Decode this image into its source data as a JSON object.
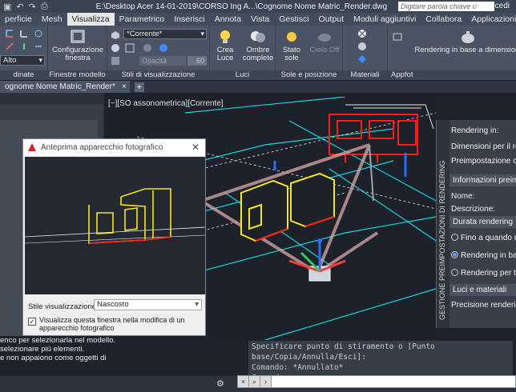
{
  "titlebar": {
    "document_path": "E:\\Desktop Acer 14-01-2019\\CORSO Ing A...\\Cognome Nome Matric_Render.dwg",
    "search_placeholder": "Digitare parola chiave o frase",
    "login_label": "Accedi"
  },
  "menu_tabs": [
    {
      "label": "perficie",
      "active": false
    },
    {
      "label": "Mesh",
      "active": false
    },
    {
      "label": "Visualizza",
      "active": true
    },
    {
      "label": "Parametrico",
      "active": false
    },
    {
      "label": "Inserisci",
      "active": false
    },
    {
      "label": "Annota",
      "active": false
    },
    {
      "label": "Vista",
      "active": false
    },
    {
      "label": "Gestisci",
      "active": false
    },
    {
      "label": "Output",
      "active": false
    },
    {
      "label": "Moduli aggiuntivi",
      "active": false
    },
    {
      "label": "Collabora",
      "active": false
    },
    {
      "label": "Applicazioni disponibili",
      "active": false
    }
  ],
  "ribbon": {
    "coord_panel": {
      "label": "dinate",
      "dropdown_value": "Alto"
    },
    "viewport_panel": {
      "label": "Finestre modello",
      "button": "Configurazione finestra"
    },
    "visual_styles_panel": {
      "label": "Stili di visualizzazione",
      "dropdown_value": "*Corrente*",
      "opacity_label": "Opacità",
      "opacity_value": "60"
    },
    "lights_panel": {
      "label": "Luci",
      "create_light": "Crea Luce",
      "shadows": "Ombre complete"
    },
    "sun_panel": {
      "label": "Sole e posizione",
      "sun_status": "Stato sole",
      "sky_off": "Cielo Off"
    },
    "materials_panel": {
      "label": "Materiali"
    },
    "render_panel": {
      "label": "Appfot",
      "render_button": "Rendering in base a dimensioni"
    }
  },
  "doc_tab": {
    "label": "ognome Nome Matric_Render*",
    "plus": "+"
  },
  "viewport_label": "[−][SO assonometrica][Corrente]",
  "help_text": [
    "enco per selezionarla nel modello.",
    "selezionare più elementi.",
    "e non appaiono come oggetti di"
  ],
  "command": {
    "history": [
      "Specificare punto di stiramento o [Punto base/Copia/Annulla/Esci]:",
      "Comando: *Annullato*",
      "Comando:"
    ],
    "prompt": ""
  },
  "render_palette": {
    "side_title": "GESTIONE PREIMPOSTAZIONI DI RENDERING",
    "rows": [
      {
        "label": "Rendering in:"
      },
      {
        "label": "Dimensioni per il rendering"
      },
      {
        "label": "Preimpostazione corrente"
      }
    ],
    "info_section": "Informazioni preimpostazione",
    "info_rows": [
      {
        "label": "Nome:"
      },
      {
        "label": "Descrizione:"
      }
    ],
    "duration_section": "Durata rendering",
    "duration_options": [
      {
        "label": "Fino a quando non",
        "selected": false
      },
      {
        "label": "Rendering in base",
        "selected": true
      },
      {
        "label": "Rendering per ter",
        "selected": false
      }
    ],
    "lights_section": "Luci e materiali",
    "precision_label": "Precisione rendering:"
  },
  "camera_dialog": {
    "title": "Anteprima apparecchio fotografico",
    "style_label": "Stile visualizzazione:",
    "style_value": "Nascosto",
    "checkbox_checked": true,
    "checkbox_label": "Visualizza questa finestra nella modifica di un apparecchio fotografico"
  },
  "colors": {
    "accent_red": "#ff1a1a",
    "accent_yellow": "#f5e61e",
    "cyan_lines": "#12d6e0",
    "active_tab": "#e6e6e6"
  }
}
